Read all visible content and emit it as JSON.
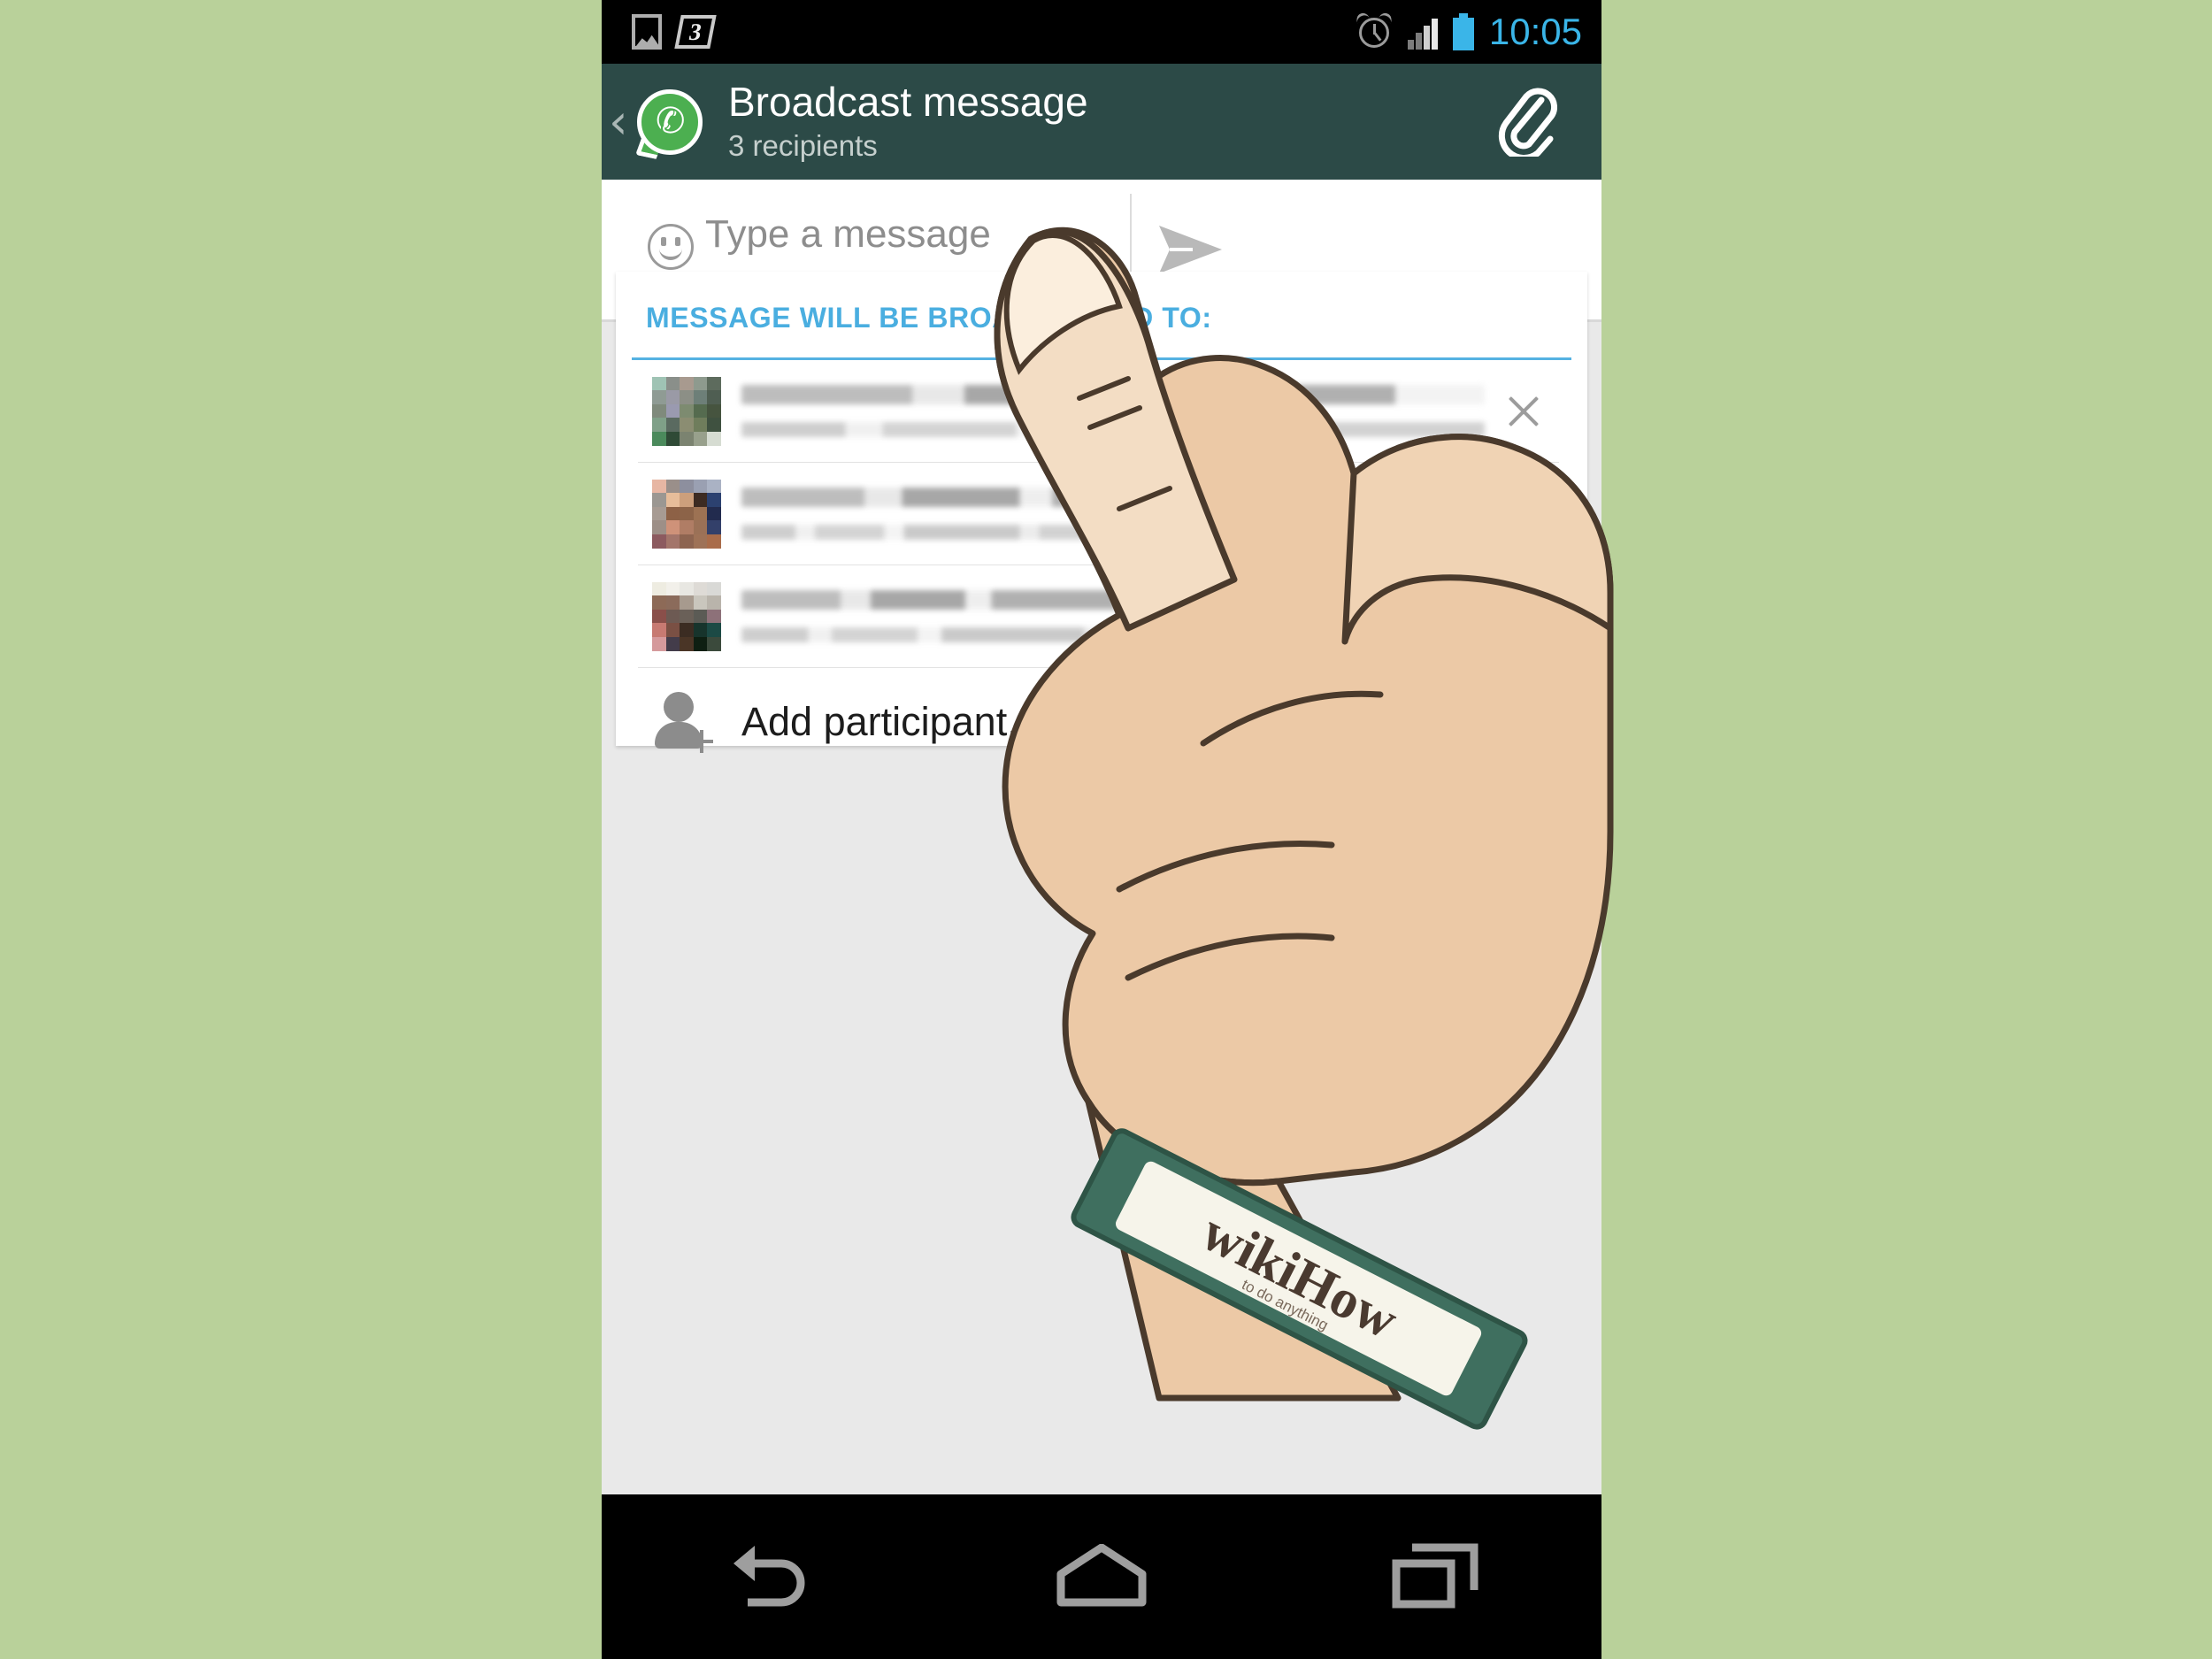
{
  "theme": {
    "page_background": "#b9d19a",
    "header_background": "#2c4a47",
    "accent_blue": "#2b96cc",
    "title_blue": "#4aaee0",
    "whatsapp_green": "#4caf50",
    "status_text_blue": "#3ab5e8",
    "screen_background": "#e9e9e9"
  },
  "status_bar": {
    "time": "10:05",
    "left_icons": [
      {
        "name": "image-icon",
        "label": "screenshot"
      },
      {
        "name": "three-badge-icon",
        "label": "3"
      }
    ],
    "right_icons": [
      {
        "name": "alarm-clock-icon",
        "label": "alarm"
      },
      {
        "name": "signal-bars-icon",
        "label": "signal"
      },
      {
        "name": "battery-icon",
        "label": "battery"
      }
    ]
  },
  "app_bar": {
    "back_glyph": "‹",
    "logo_name": "whatsapp-logo",
    "title": "Broadcast message",
    "subtitle": "3 recipients",
    "attach_icon": "paperclip-icon"
  },
  "compose": {
    "emoji_icon": "emoji-smiley-icon",
    "placeholder": "Type a message",
    "value": "",
    "send_icon": "send-arrow-icon"
  },
  "broadcast_card": {
    "title": "MESSAGE WILL BE BROADCASTED TO:",
    "recipients": [
      {
        "name": "",
        "status": "",
        "remove_icon": "close-icon"
      },
      {
        "name": "",
        "status": "",
        "remove_icon": "close-icon"
      },
      {
        "name": "",
        "status": "",
        "remove_icon": "close-icon"
      }
    ],
    "add_participant": {
      "icon": "add-person-icon",
      "label": "Add participant..."
    }
  },
  "nav_bar": {
    "buttons": [
      {
        "name": "back-button",
        "icon": "back-arrow-icon"
      },
      {
        "name": "home-button",
        "icon": "home-icon"
      },
      {
        "name": "recents-button",
        "icon": "recent-apps-icon"
      }
    ]
  },
  "illustration": {
    "wristband_logo": "wikiHow",
    "wristband_sub": "to do anything",
    "pointer": "index-finger-pointing"
  }
}
